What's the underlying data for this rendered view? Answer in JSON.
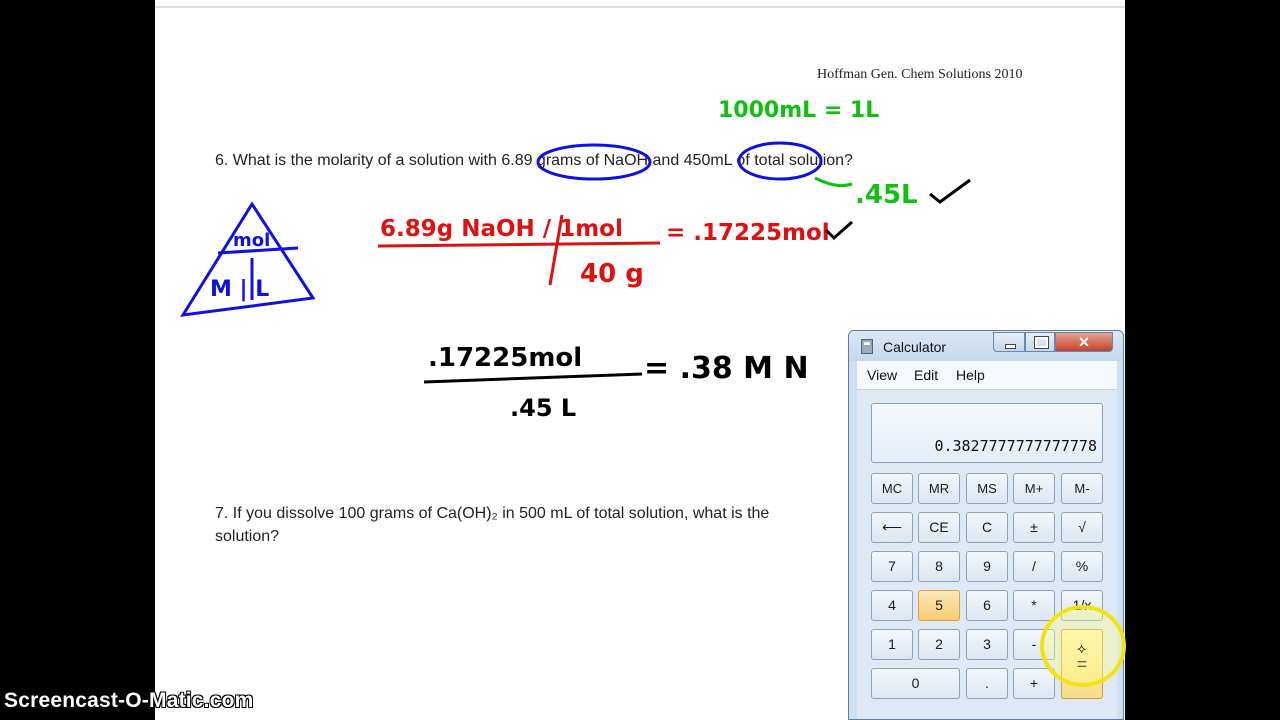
{
  "document": {
    "header_note": "Hoffman Gen. Chem Solutions 2010",
    "q6": "6.  What is the molarity of a solution with 6.89 grams of NaOH and 450mL of total solution?",
    "q7_line1": "7.  If you dissolve 100 grams of Ca(OH)₂ in 500 mL of total solution, what is the",
    "q7_line2": "solution?"
  },
  "annotations": {
    "green_conversion": "1000mL = 1L",
    "green_liters": ".45L",
    "triangle_top": "mol",
    "triangle_bottom": "M | L",
    "red_numerator": "6.89g NaOH / 1mol",
    "red_result": "= .17225mol",
    "red_denominator": "40 g",
    "black_numerator": ".17225mol",
    "black_denominator": ".45 L",
    "black_result": "= .38 M N",
    "colors": {
      "blue": "#1010e0",
      "red": "#e01010",
      "green": "#10c010",
      "black": "#000000"
    }
  },
  "calculator": {
    "title": "Calculator",
    "menu": [
      "View",
      "Edit",
      "Help"
    ],
    "display": "0.3827777777777778",
    "keys": {
      "mc": "MC",
      "mr": "MR",
      "ms": "MS",
      "mplus": "M+",
      "mminus": "M-",
      "back": "⟵",
      "ce": "CE",
      "c": "C",
      "pm": "±",
      "sqrt": "√",
      "k7": "7",
      "k8": "8",
      "k9": "9",
      "div": "/",
      "pct": "%",
      "k4": "4",
      "k5": "5",
      "k6": "6",
      "mul": "*",
      "inv": "1/x",
      "k1": "1",
      "k2": "2",
      "k3": "3",
      "sub": "-",
      "eq": "=",
      "k0": "0",
      "dot": ".",
      "add": "+"
    }
  },
  "watermark": "Screencast-O-Matic.com"
}
